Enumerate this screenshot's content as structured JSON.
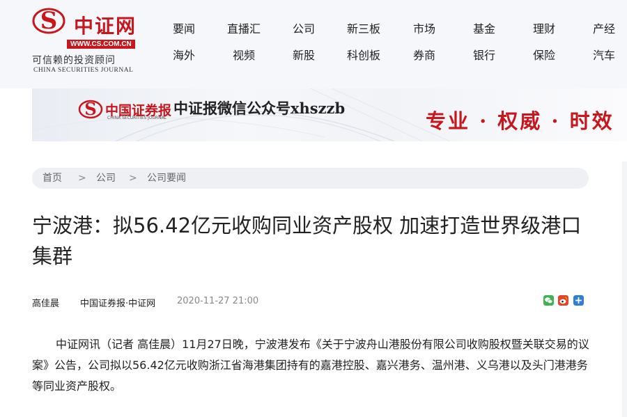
{
  "logo": {
    "title": "中证网",
    "url": "WWW.CS.COM.CN",
    "slogan": "可信赖的投资顾问",
    "english": "CHINA SECURITIES JOURNAL"
  },
  "nav": {
    "row1": [
      "要闻",
      "直播汇",
      "公司",
      "新三板",
      "市场",
      "基金",
      "理财",
      "产经"
    ],
    "row2": [
      "海外",
      "视频",
      "新股",
      "科创板",
      "券商",
      "银行",
      "保险",
      "汽车"
    ]
  },
  "banner": {
    "logo_text": "中国证券报",
    "logo_english": "CHINA SECURITIES JOURNAL",
    "wechat_text": "中证报微信公众号xhszzb",
    "slogan": "专业 · 权威 · 时效"
  },
  "breadcrumb": {
    "items": [
      "首页",
      "公司",
      "公司要闻"
    ],
    "separator": ">"
  },
  "article": {
    "title": "宁波港：拟56.42亿元收购同业资产股权 加速打造世界级港口集群",
    "author": "高佳晨",
    "source": "中国证券报·中证网",
    "time": "2020-11-27 21:00",
    "paragraph1": "中证网讯（记者 高佳晨）11月27日晚，宁波港发布《关于宁波舟山港股份有限公司收购股权暨关联交易的议案》公告，公司拟以56.42亿元收购浙江省海港集团持有的嘉港控股、嘉兴港务、温州港、义乌港以及头门港港务等同业资产股权。"
  },
  "share_icons": [
    "wechat-icon",
    "weibo-icon",
    "more-share-icon"
  ],
  "colors": {
    "brand_red": "#c8161d",
    "breadcrumb_bg": "#eef0f4",
    "header_bg": "#f5f7fb"
  }
}
